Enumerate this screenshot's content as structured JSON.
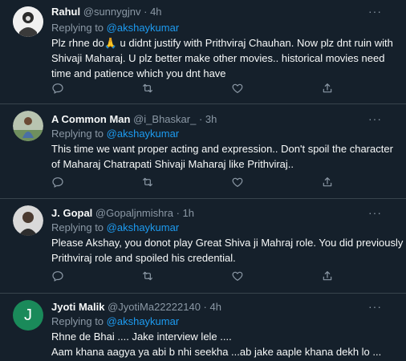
{
  "colors": {
    "background": "#15202b",
    "divider": "#38444d",
    "muted": "#8b98a5",
    "mention": "#1d9bf0",
    "text": "#f7f9f9"
  },
  "replies": [
    {
      "name": "Rahul",
      "handle": "@sunnygjnv",
      "time": "· 4h",
      "replying_prefix": "Replying to",
      "replying_to": "@akshaykumar",
      "lines": [
        "Plz rhne do🙏 u didnt justify with Prithviraj Chauhan. Now plz dnt ruin with",
        "Shivaji Maharaj. U plz better make other movies.. historical movies need",
        "time and patience which you dnt have"
      ],
      "more_icon": "more-icon"
    },
    {
      "name": "A Common Man",
      "handle": "@i_Bhaskar_",
      "time": "· 3h",
      "replying_prefix": "Replying to",
      "replying_to": "@akshaykumar",
      "lines": [
        "This time we want proper acting and expression.. Don't spoil the character",
        "of Maharaj Chatrapati Shivaji Maharaj like Prithviraj.."
      ],
      "more_icon": "more-icon"
    },
    {
      "name": "J. Gopal",
      "handle": "@Gopaljnmishra",
      "time": "· 1h",
      "replying_prefix": "Replying to",
      "replying_to": "@akshaykumar",
      "lines": [
        "Please Akshay, you donot play Great Shiva ji Mahraj role. You did previously",
        "Prithviraj role and spoiled his credential."
      ],
      "more_icon": "more-icon"
    },
    {
      "name": "Jyoti Malik",
      "handle": "@JyotiMa22222140",
      "time": "· 4h",
      "replying_prefix": "Replying to",
      "replying_to": "@akshaykumar",
      "avatar_letter": "J",
      "lines": [
        "Rhne de Bhai .... Jake interview lele ....",
        "Aam khana aagya ya abi b nhi seekha ...ab jake aaple khana dekh lo ..."
      ],
      "more_icon": "more-icon"
    }
  ],
  "more_label": "···"
}
